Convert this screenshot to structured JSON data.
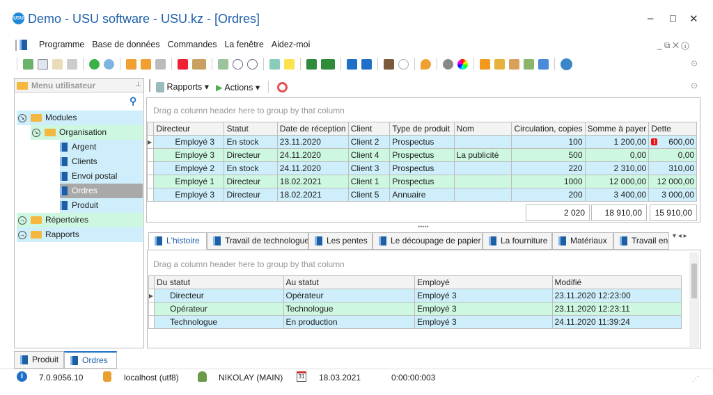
{
  "window": {
    "title": "Demo - USU software - USU.kz - [Ordres]",
    "logo": "USU"
  },
  "menu": [
    "Programme",
    "Base de données",
    "Commandes",
    "La fenêtre",
    "Aidez-moi"
  ],
  "sidebar": {
    "header": "Menu utilisateur",
    "tree": [
      {
        "label": "Modules",
        "level": 0,
        "icon": "folder-open"
      },
      {
        "label": "Organisation",
        "level": 1,
        "icon": "folder-open"
      },
      {
        "label": "Argent",
        "level": 2,
        "icon": "document"
      },
      {
        "label": "Clients",
        "level": 2,
        "icon": "document"
      },
      {
        "label": "Envoi postal",
        "level": 2,
        "icon": "document"
      },
      {
        "label": "Ordres",
        "level": 2,
        "icon": "document",
        "selected": true
      },
      {
        "label": "Produit",
        "level": 2,
        "icon": "document"
      },
      {
        "label": "Répertoires",
        "level": 0,
        "icon": "folder"
      },
      {
        "label": "Rapports",
        "level": 0,
        "icon": "folder"
      }
    ]
  },
  "toolbar2": {
    "reports": "Rapports",
    "actions": "Actions"
  },
  "main_grid": {
    "group_hint": "Drag a column header here to group by that column",
    "columns": [
      "Directeur",
      "Statut",
      "Date de réception",
      "Client",
      "Type de produit",
      "Nom",
      "Circulation, copies",
      "Somme à payer",
      "Dette"
    ],
    "rows": [
      [
        "Employé 3",
        "En stock",
        "23.11.2020",
        "Client 2",
        "Prospectus",
        "",
        "100",
        "1 200,00",
        "600,00"
      ],
      [
        "Employé 3",
        "Directeur",
        "24.11.2020",
        "Client 4",
        "Prospectus",
        "La publicité",
        "500",
        "0,00",
        "0,00"
      ],
      [
        "Employé 2",
        "En stock",
        "24.11.2020",
        "Client 3",
        "Prospectus",
        "",
        "220",
        "2 310,00",
        "310,00"
      ],
      [
        "Employé 1",
        "Directeur",
        "18.02.2021",
        "Client 1",
        "Prospectus",
        "",
        "1000",
        "12 000,00",
        "12 000,00"
      ],
      [
        "Employé 3",
        "Directeur",
        "18.02.2021",
        "Client 5",
        "Annuaire",
        "",
        "200",
        "3 400,00",
        "3 000,00"
      ]
    ],
    "totals": [
      "2 020",
      "18 910,00",
      "15 910,00"
    ]
  },
  "tabs": [
    "L'histoire",
    "Travail de technologue",
    "Les pentes",
    "Le découpage de papier",
    "La fourniture",
    "Matériaux",
    "Travail en"
  ],
  "history_grid": {
    "group_hint": "Drag a column header here to group by that column",
    "columns": [
      "Du statut",
      "Au statut",
      "Employé",
      "Modifié"
    ],
    "rows": [
      [
        "Directeur",
        "Opérateur",
        "Employé 3",
        "23.11.2020 12:23:00"
      ],
      [
        "Opérateur",
        "Technologue",
        "Employé 3",
        "23.11.2020 12:23:11"
      ],
      [
        "Technologue",
        "En production",
        "Employé 3",
        "24.11.2020 11:39:24"
      ]
    ]
  },
  "bottom_tabs": [
    "Produit",
    "Ordres"
  ],
  "status": {
    "version": "7.0.9056.10",
    "db": "localhost (utf8)",
    "user": "NIKOLAY (MAIN)",
    "date": "18.03.2021",
    "timer": "0:00:00:003",
    "calendar_day": "31"
  }
}
